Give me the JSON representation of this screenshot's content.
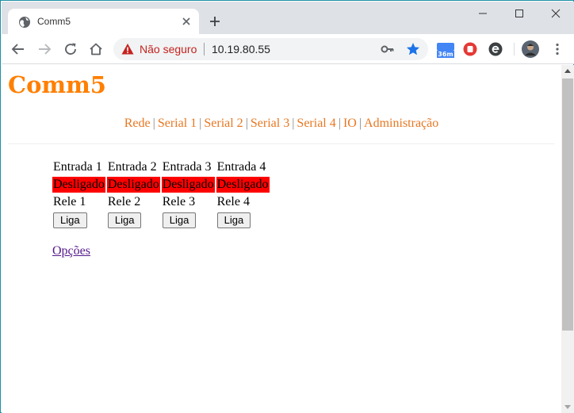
{
  "browser": {
    "tab_title": "Comm5",
    "security_label": "Não seguro",
    "url": "10.19.80.55",
    "extension_badge": "36m"
  },
  "page": {
    "site_title": "Comm5",
    "nav": [
      "Rede",
      "Serial 1",
      "Serial 2",
      "Serial 3",
      "Serial 4",
      "IO",
      "Administração"
    ],
    "nav_separator": "|",
    "inputs": {
      "labels": [
        "Entrada 1",
        "Entrada 2",
        "Entrada 3",
        "Entrada 4"
      ],
      "states": [
        "Desligado",
        "Desligado",
        "Desligado",
        "Desligado"
      ]
    },
    "relays": {
      "labels": [
        "Rele 1",
        "Rele 2",
        "Rele 3",
        "Rele 4"
      ],
      "buttons": [
        "Liga",
        "Liga",
        "Liga",
        "Liga"
      ]
    },
    "options_link": "Opções"
  },
  "colors": {
    "accent": "#ff7f00",
    "state_off": "#ff0000",
    "link_visited": "#551a8b",
    "security_warning": "#c5221f"
  }
}
